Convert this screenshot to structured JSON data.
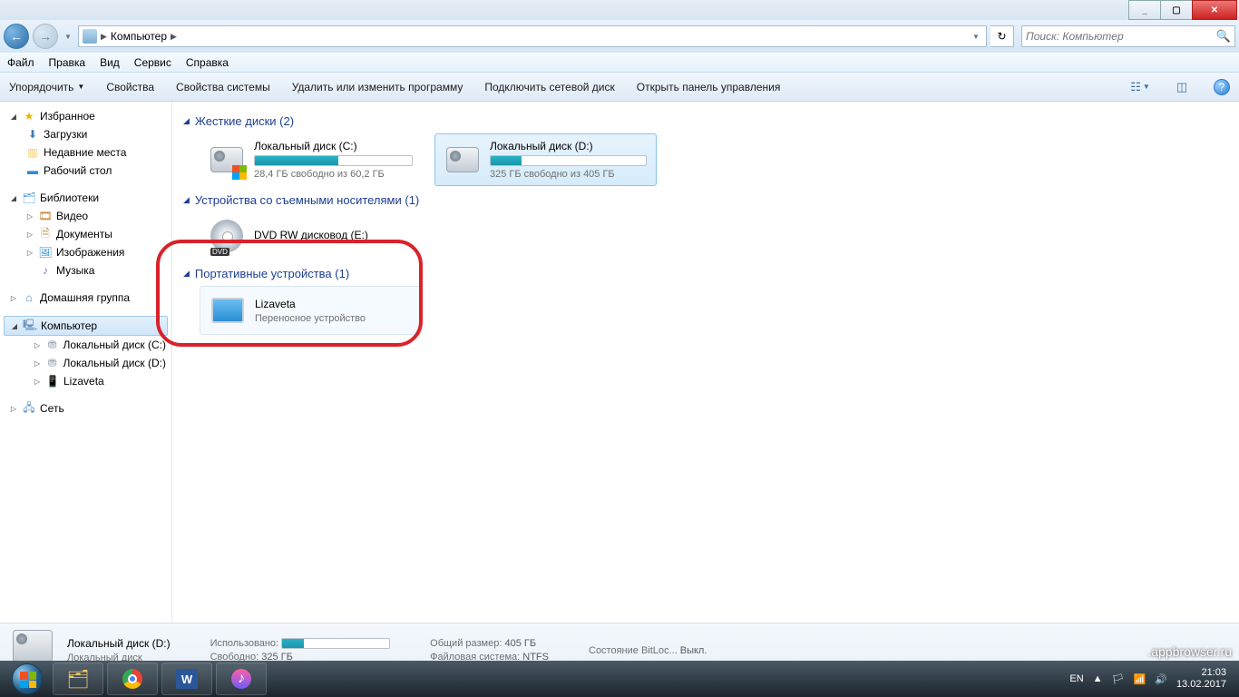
{
  "window": {
    "min": "_",
    "max": "▢",
    "close": "✕"
  },
  "address": {
    "location": "Компьютер",
    "search_placeholder": "Поиск: Компьютер"
  },
  "menu": {
    "file": "Файл",
    "edit": "Правка",
    "view": "Вид",
    "service": "Сервис",
    "help": "Справка"
  },
  "toolbar": {
    "organize": "Упорядочить",
    "props": "Свойства",
    "sysprops": "Свойства системы",
    "uninstall": "Удалить или изменить программу",
    "netdrive": "Подключить сетевой диск",
    "ctrl": "Открыть панель управления"
  },
  "sidebar": {
    "fav": "Избранное",
    "downloads": "Загрузки",
    "recent": "Недавние места",
    "desktop": "Рабочий стол",
    "libs": "Библиотеки",
    "video": "Видео",
    "docs": "Документы",
    "images": "Изображения",
    "music": "Музыка",
    "homegroup": "Домашняя группа",
    "computer": "Компьютер",
    "driveC": "Локальный диск (C:)",
    "driveD": "Локальный диск (D:)",
    "lizaveta": "Lizaveta",
    "network": "Сеть"
  },
  "groups": {
    "hdd": "Жесткие диски (2)",
    "removable": "Устройства со съемными носителями (1)",
    "portable": "Портативные устройства (1)"
  },
  "drives": {
    "c": {
      "name": "Локальный диск (C:)",
      "info": "28,4 ГБ свободно из 60,2 ГБ",
      "fill": 53
    },
    "d": {
      "name": "Локальный диск (D:)",
      "info": "325 ГБ свободно из 405 ГБ",
      "fill": 20
    },
    "dvd": {
      "name": "DVD RW дисковод (E:)"
    },
    "liz": {
      "name": "Lizaveta",
      "sub": "Переносное устройство"
    }
  },
  "details": {
    "title": "Локальный диск (D:)",
    "sub": "Локальный диск",
    "used_k": "Использовано:",
    "free_k": "Свободно:",
    "free_v": "325 ГБ",
    "total_k": "Общий размер:",
    "total_v": "405 ГБ",
    "fs_k": "Файловая система:",
    "fs_v": "NTFS",
    "bit_k": "Состояние BitLoc...",
    "bit_v": "Выкл."
  },
  "tray": {
    "lang": "EN",
    "time": "21:03",
    "date": "13.02.2017"
  },
  "watermark": ".appbrowser.ru"
}
